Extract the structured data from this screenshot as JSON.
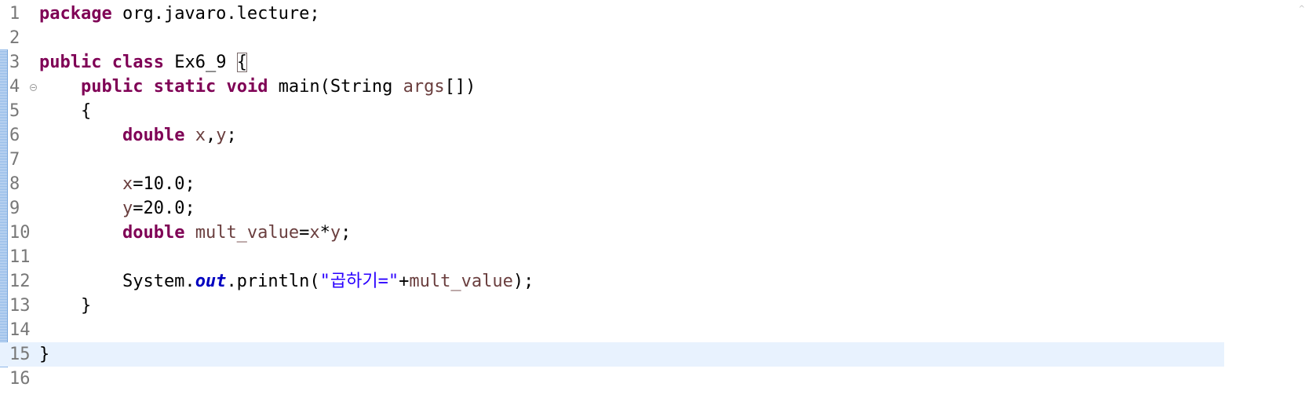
{
  "editor": {
    "language": "java",
    "current_line": 15,
    "colors": {
      "keyword": "#7f0055",
      "local_variable": "#6a3e3e",
      "string": "#2a00ff",
      "static_field": "#0000c0",
      "line_number": "#787878",
      "current_line_highlight": "#e8f2fe",
      "change_bar": "#8fb8e8"
    },
    "lines": [
      {
        "num": "1",
        "tokens": [
          {
            "t": "package",
            "c": "kw"
          },
          {
            "t": " org.javaro.lecture;"
          }
        ]
      },
      {
        "num": "2",
        "tokens": []
      },
      {
        "num": "3",
        "tokens": [
          {
            "t": "public",
            "c": "kw"
          },
          {
            "t": " "
          },
          {
            "t": "class",
            "c": "kw"
          },
          {
            "t": " Ex6_9 "
          },
          {
            "t": "{",
            "c": "brace-match"
          }
        ]
      },
      {
        "num": "4",
        "fold": true,
        "tokens": [
          {
            "t": "    "
          },
          {
            "t": "public",
            "c": "kw"
          },
          {
            "t": " "
          },
          {
            "t": "static",
            "c": "kw"
          },
          {
            "t": " "
          },
          {
            "t": "void",
            "c": "kw"
          },
          {
            "t": " main(String "
          },
          {
            "t": "args",
            "c": "var"
          },
          {
            "t": "[])"
          }
        ]
      },
      {
        "num": "5",
        "tokens": [
          {
            "t": "    {"
          }
        ]
      },
      {
        "num": "6",
        "tokens": [
          {
            "t": "        "
          },
          {
            "t": "double",
            "c": "kw"
          },
          {
            "t": " "
          },
          {
            "t": "x",
            "c": "var"
          },
          {
            "t": ","
          },
          {
            "t": "y",
            "c": "var"
          },
          {
            "t": ";"
          }
        ]
      },
      {
        "num": "7",
        "tokens": []
      },
      {
        "num": "8",
        "tokens": [
          {
            "t": "        "
          },
          {
            "t": "x",
            "c": "var"
          },
          {
            "t": "=10.0;"
          }
        ]
      },
      {
        "num": "9",
        "tokens": [
          {
            "t": "        "
          },
          {
            "t": "y",
            "c": "var"
          },
          {
            "t": "=20.0;"
          }
        ]
      },
      {
        "num": "10",
        "tokens": [
          {
            "t": "        "
          },
          {
            "t": "double",
            "c": "kw"
          },
          {
            "t": " "
          },
          {
            "t": "mult_value",
            "c": "var"
          },
          {
            "t": "="
          },
          {
            "t": "x",
            "c": "var"
          },
          {
            "t": "*"
          },
          {
            "t": "y",
            "c": "var"
          },
          {
            "t": ";"
          }
        ]
      },
      {
        "num": "11",
        "tokens": []
      },
      {
        "num": "12",
        "tokens": [
          {
            "t": "        System."
          },
          {
            "t": "out",
            "c": "static-field"
          },
          {
            "t": ".println("
          },
          {
            "t": "\"곱하기=\"",
            "c": "str"
          },
          {
            "t": "+"
          },
          {
            "t": "mult_value",
            "c": "var"
          },
          {
            "t": ");"
          }
        ]
      },
      {
        "num": "13",
        "tokens": [
          {
            "t": "    }"
          }
        ]
      },
      {
        "num": "14",
        "tokens": []
      },
      {
        "num": "15",
        "tokens": [
          {
            "t": "}"
          }
        ]
      },
      {
        "num": "16",
        "tokens": []
      }
    ]
  }
}
